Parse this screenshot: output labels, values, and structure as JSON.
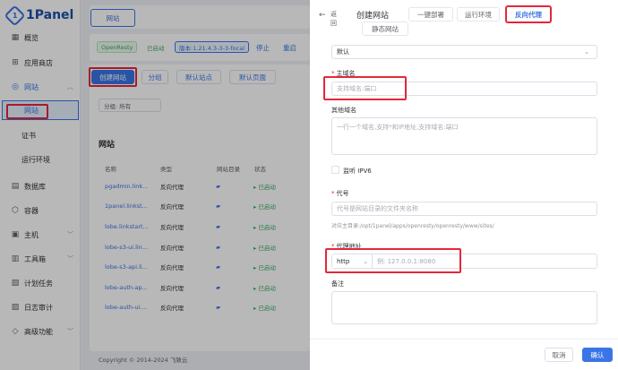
{
  "sidebar": {
    "brand": "1Panel",
    "items": [
      {
        "label": "概览",
        "icon": "overview-icon",
        "glyph": "▦"
      },
      {
        "label": "应用商店",
        "icon": "app-store-icon",
        "glyph": "⊞"
      },
      {
        "label": "网站",
        "icon": "website-icon",
        "glyph": "◎"
      },
      {
        "label": "网站",
        "icon": "",
        "glyph": ""
      },
      {
        "label": "证书",
        "icon": "",
        "glyph": ""
      },
      {
        "label": "运行环境",
        "icon": "",
        "glyph": ""
      },
      {
        "label": "数据库",
        "icon": "database-icon",
        "glyph": "▤"
      },
      {
        "label": "容器",
        "icon": "container-icon",
        "glyph": "⬡"
      },
      {
        "label": "主机",
        "icon": "host-icon",
        "glyph": "▣"
      },
      {
        "label": "工具箱",
        "icon": "toolbox-icon",
        "glyph": "▥"
      },
      {
        "label": "计划任务",
        "icon": "cron-icon",
        "glyph": "▧"
      },
      {
        "label": "日志审计",
        "icon": "log-icon",
        "glyph": "▨"
      },
      {
        "label": "高级功能",
        "icon": "advanced-icon",
        "glyph": "◇"
      }
    ]
  },
  "main": {
    "top_tab": "网站",
    "openresty_tag": "OpenResty",
    "status_tag": "已启动",
    "version_tag": "版本:1.21.4.3-3-3-focal",
    "stop": "停止",
    "restart": "重启",
    "create_site": "创建网站",
    "group": "分组",
    "default_site": "默认站点",
    "default_page": "默认页面",
    "group_filter": "分组: 所有",
    "section_title": "网站",
    "columns": [
      "名称",
      "类型",
      "网站目录",
      "状态"
    ],
    "rows": [
      {
        "name": "pgadmin.link...",
        "type": "反向代理",
        "status": "已启动"
      },
      {
        "name": "1panel.linkst...",
        "type": "反向代理",
        "status": "已启动"
      },
      {
        "name": "lobe.linkstart...",
        "type": "反向代理",
        "status": "已启动"
      },
      {
        "name": "lobe-s3-ui.lin...",
        "type": "反向代理",
        "status": "已启动"
      },
      {
        "name": "lobe-s3-api.li...",
        "type": "反向代理",
        "status": "已启动"
      },
      {
        "name": "lobe-auth-ap...",
        "type": "反向代理",
        "status": "已启动"
      },
      {
        "name": "lobe-auth-ui....",
        "type": "反向代理",
        "status": "已启动"
      }
    ],
    "copyright": "Copyright © 2014-2024 飞致云"
  },
  "drawer": {
    "back": "返回",
    "title": "创建网站",
    "tabs": [
      "一键部署",
      "运行环境",
      "反向代理",
      "静态网站"
    ],
    "group_value": "默认",
    "primary_domain_label": "主域名",
    "primary_domain_placeholder": "支持域名:端口",
    "other_domains_label": "其他域名",
    "other_domains_placeholder": "一行一个域名,支持*和IP地址,支持域名:端口",
    "ipv6_label": "监听 IPV6",
    "alias_label": "代号",
    "alias_placeholder": "代号是网站目录的文件夹名称",
    "alias_hint": "对应主目录:/opt/1panel/apps/openresty/openresty/www/sites/",
    "proxy_label": "代理地址",
    "proxy_scheme": "http",
    "proxy_placeholder": "例: 127.0.0.1:8080",
    "remark_label": "备注",
    "cancel": "取消",
    "confirm": "确认"
  },
  "colors": {
    "accent": "#3a75e6",
    "highlight": "#e5273a",
    "success": "#3aae5e"
  }
}
